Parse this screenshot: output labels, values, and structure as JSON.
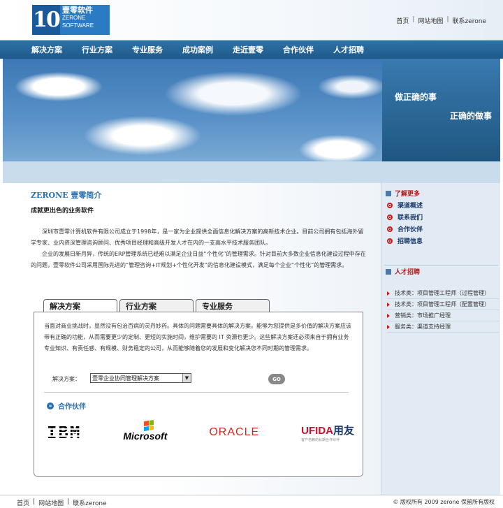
{
  "logo": {
    "number": "10",
    "cn": "壹零软件",
    "en1": "ZERONE",
    "en2": "SOFTWARE"
  },
  "toplinks": {
    "home": "首页",
    "sitemap": "网站地图",
    "contact": "联系zerone"
  },
  "nav": [
    "解决方案",
    "行业方案",
    "专业服务",
    "成功案例",
    "走近壹零",
    "合作伙伴",
    "人才招聘"
  ],
  "slogan": {
    "line1": "做正确的事",
    "line2": "正确的做事"
  },
  "intro": {
    "title_en": "ZERONE",
    "title_cn": "壹零简介",
    "subtitle": "成就更出色的业务软件",
    "para1": "深圳市壹零计算机软件有限公司成立于1998年，是一家为企业提供全面信息化解决方案的高新技术企业。目前公司拥有包括海外留学专家、业内资深管理咨询顾问、优秀项目经理和高级开发人才在内的一支高水平技术服务团队。",
    "para2": "企业的发展日新月异，传统的ERP管理系统已经难以满足企业日益“个性化”的管理需求。针对目前大多数企业信息化建设过程中存在的问题，壹零软件公司采用国际先进的“管理咨询+IT规划+个性化开发”的信息化建设模式，满足每个企业“个性化”的管理需求。"
  },
  "tabs": [
    "解决方案",
    "行业方案",
    "专业服务"
  ],
  "panel": {
    "text": "当面对商业挑战时，显然没有包治百病的灵丹妙药。具体的问题需要具体的解决方案。能够为您提供是多价值的解决方案应该带有正确的功能，从而需要更少的定制、更短的实施时间，维护需要的 IT 资源也更少。这些解决方案还必须来自于拥有业务专业知识、有责任感、有规模、财务稳定的公司，从而能够随着您的发展和变化解决您不同时期的管理需求。",
    "select_label": "解决方案：",
    "select_value": "壹零企业协同管理解决方案",
    "go_label": "GO",
    "partners_title": "合作伙伴",
    "partners": {
      "ibm": "IBM",
      "microsoft": "Microsoft",
      "oracle": "ORACLE",
      "ufida": "UFIDA",
      "ufida_cn": "用友",
      "ufida_slogan": "客户信赖的长期合作伙伴"
    }
  },
  "aside": {
    "links_title": "了解更多",
    "links": [
      "渠道概述",
      "联系我们",
      "合作伙伴",
      "招聘信息"
    ],
    "jobs_title": "人才招聘",
    "jobs": [
      "技术类：项目管理工程师（过程管理）",
      "技术类：项目管理工程师（配置管理）",
      "营销类：市场推广经理",
      "服务类：渠道支持经理"
    ]
  },
  "footer": {
    "home": "首页",
    "sitemap": "网站地图",
    "contact": "联系zerone",
    "copyright": "© 版权所有 2009 zerone 保留所有版权"
  },
  "colors": {
    "nav": "#2a6a9e",
    "accent": "#2a6fb0",
    "red": "#b01818",
    "aside_bg": "#e2ebf4"
  }
}
